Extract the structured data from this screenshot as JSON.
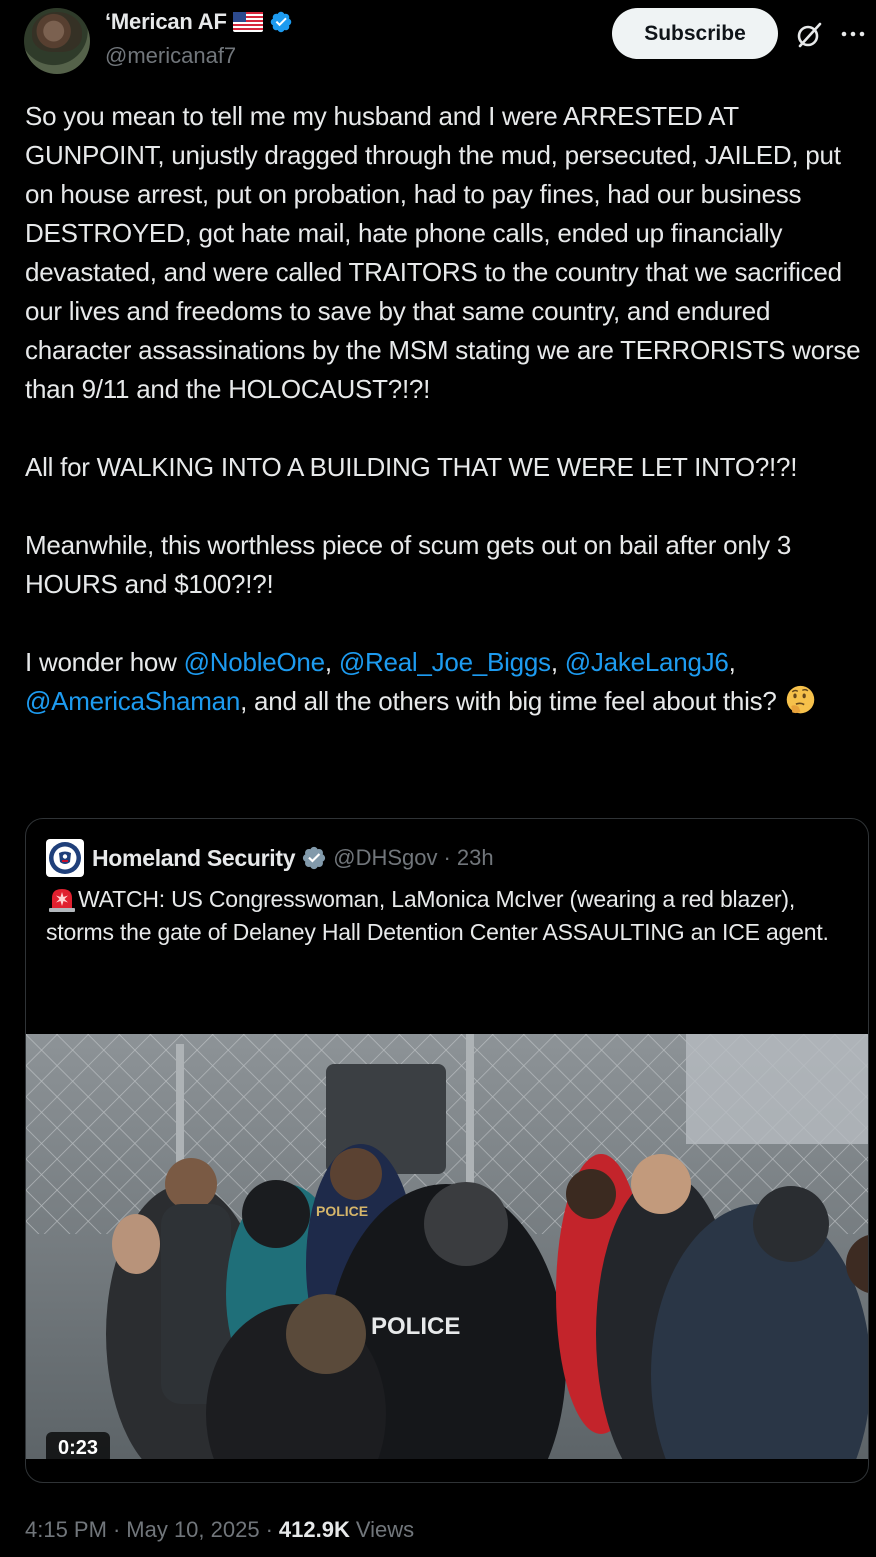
{
  "author": {
    "display_name": "‘Merican AF",
    "handle": "@mericanaf7",
    "flag_icon": "us-flag-icon",
    "verified": true
  },
  "actions": {
    "subscribe_label": "Subscribe",
    "grok_icon": "grok-icon",
    "more_icon": "more-icon"
  },
  "post": {
    "p1": "So you mean to tell me my husband and I were ARRESTED AT GUNPOINT, unjustly dragged through the mud, persecuted, JAILED, put on house arrest, put on probation, had to pay fines, had our business DESTROYED, got hate mail, hate phone calls, ended up financially devastated, and were called TRAITORS to the country that we sacrificed our lives and freedoms to save by that same country, and endured character assassinations by the MSM stating we are TERRORISTS worse than 9/11 and the HOLOCAUST?!?!",
    "p2": "All for WALKING INTO A BUILDING THAT WE WERE LET INTO?!?!",
    "p3": "Meanwhile, this worthless piece of scum gets out on bail after only 3 HOURS and $100?!?!",
    "p4_prefix": "I wonder how ",
    "mentions": [
      "@NobleOne",
      "@Real_Joe_Biggs",
      "@JakeLangJ6",
      "@AmericaShaman"
    ],
    "sep1": ",  ",
    "sep2": ", ",
    "sep3": ",",
    "p4_suffix": ", and all the others with big time feel about this? ",
    "emoji": "thinking-face-emoji"
  },
  "quote": {
    "name": "Homeland Security",
    "handle": "@DHSgov",
    "dot": "·",
    "time": "23h",
    "text": "WATCH: US Congresswoman, LaMonica McIver (wearing a red blazer), storms the gate of Delaney Hall Detention Center ASSAULTING an ICE agent.",
    "siren_icon": "siren-icon",
    "video_duration": "0:23",
    "jacket_labels": [
      "POLICE",
      "POLICE"
    ]
  },
  "meta": {
    "time": "4:15 PM",
    "dot": "·",
    "date": "May 10, 2025",
    "dot2": "·",
    "views_count": "412.9K",
    "views_label": "Views"
  },
  "colors": {
    "background": "#000000",
    "text": "#e7e9ea",
    "secondary": "#71767b",
    "link": "#1d9bf0",
    "verified": "#1d9bf0",
    "border": "#2f3336"
  }
}
